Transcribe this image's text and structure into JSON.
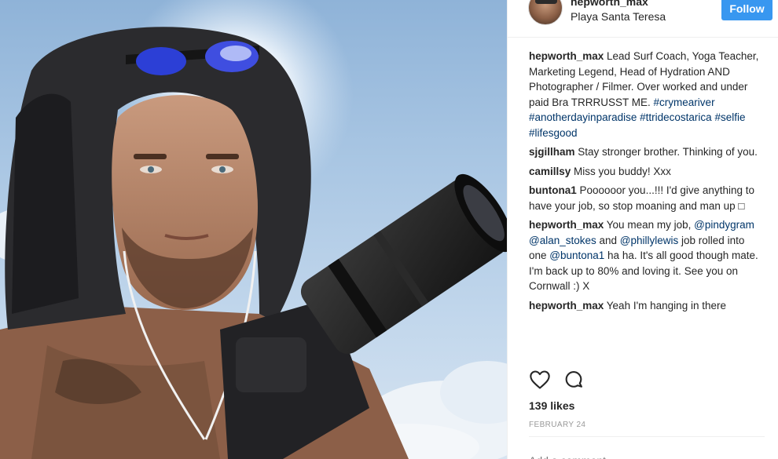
{
  "post": {
    "username": "hepworth_max",
    "location": "Playa Santa Teresa",
    "follow_label": "Follow",
    "likes": "139 likes",
    "date": "FEBRUARY 24",
    "add_comment_placeholder": "Add a comment..."
  },
  "comments": [
    {
      "user": "hepworth_max",
      "text": " Lead Surf Coach, Yoga Teacher, Marketing Legend, Head of Hydration AND Photographer / Filmer. Over worked and under paid Bra TRRRUSST ME. ",
      "tags": [
        "#crymeariver",
        "#anotherdayinparadise",
        "#ttridecostarica",
        "#selfie",
        "#lifesgood"
      ]
    },
    {
      "user": "sjgillham",
      "text": " Stay stronger brother. Thinking of you."
    },
    {
      "user": "camillsy",
      "text": " Miss you buddy! Xxx"
    },
    {
      "user": "buntona1",
      "text": " Poooooor you...!!! I'd give anything to have your job, so stop moaning and man up □"
    },
    {
      "user": "hepworth_max",
      "part1": " You mean my job, ",
      "mention1": "@pindygram",
      "mention2": "@alan_stokes",
      "part2": " and ",
      "mention3": "@phillylewis",
      "part3": " job rolled into one ",
      "mention4": "@buntona1",
      "part4": " ha ha. It's all good though mate. I'm back up to 80% and loving it. See you on Cornwall :) X"
    },
    {
      "user": "hepworth_max",
      "text": " Yeah I'm hanging in there"
    }
  ],
  "icons": {
    "like": "heart-icon",
    "comment": "speech-bubble-icon"
  },
  "colors": {
    "follow_button": "#3897f0",
    "hashtag": "#003569",
    "text": "#262626",
    "muted": "#999999"
  }
}
